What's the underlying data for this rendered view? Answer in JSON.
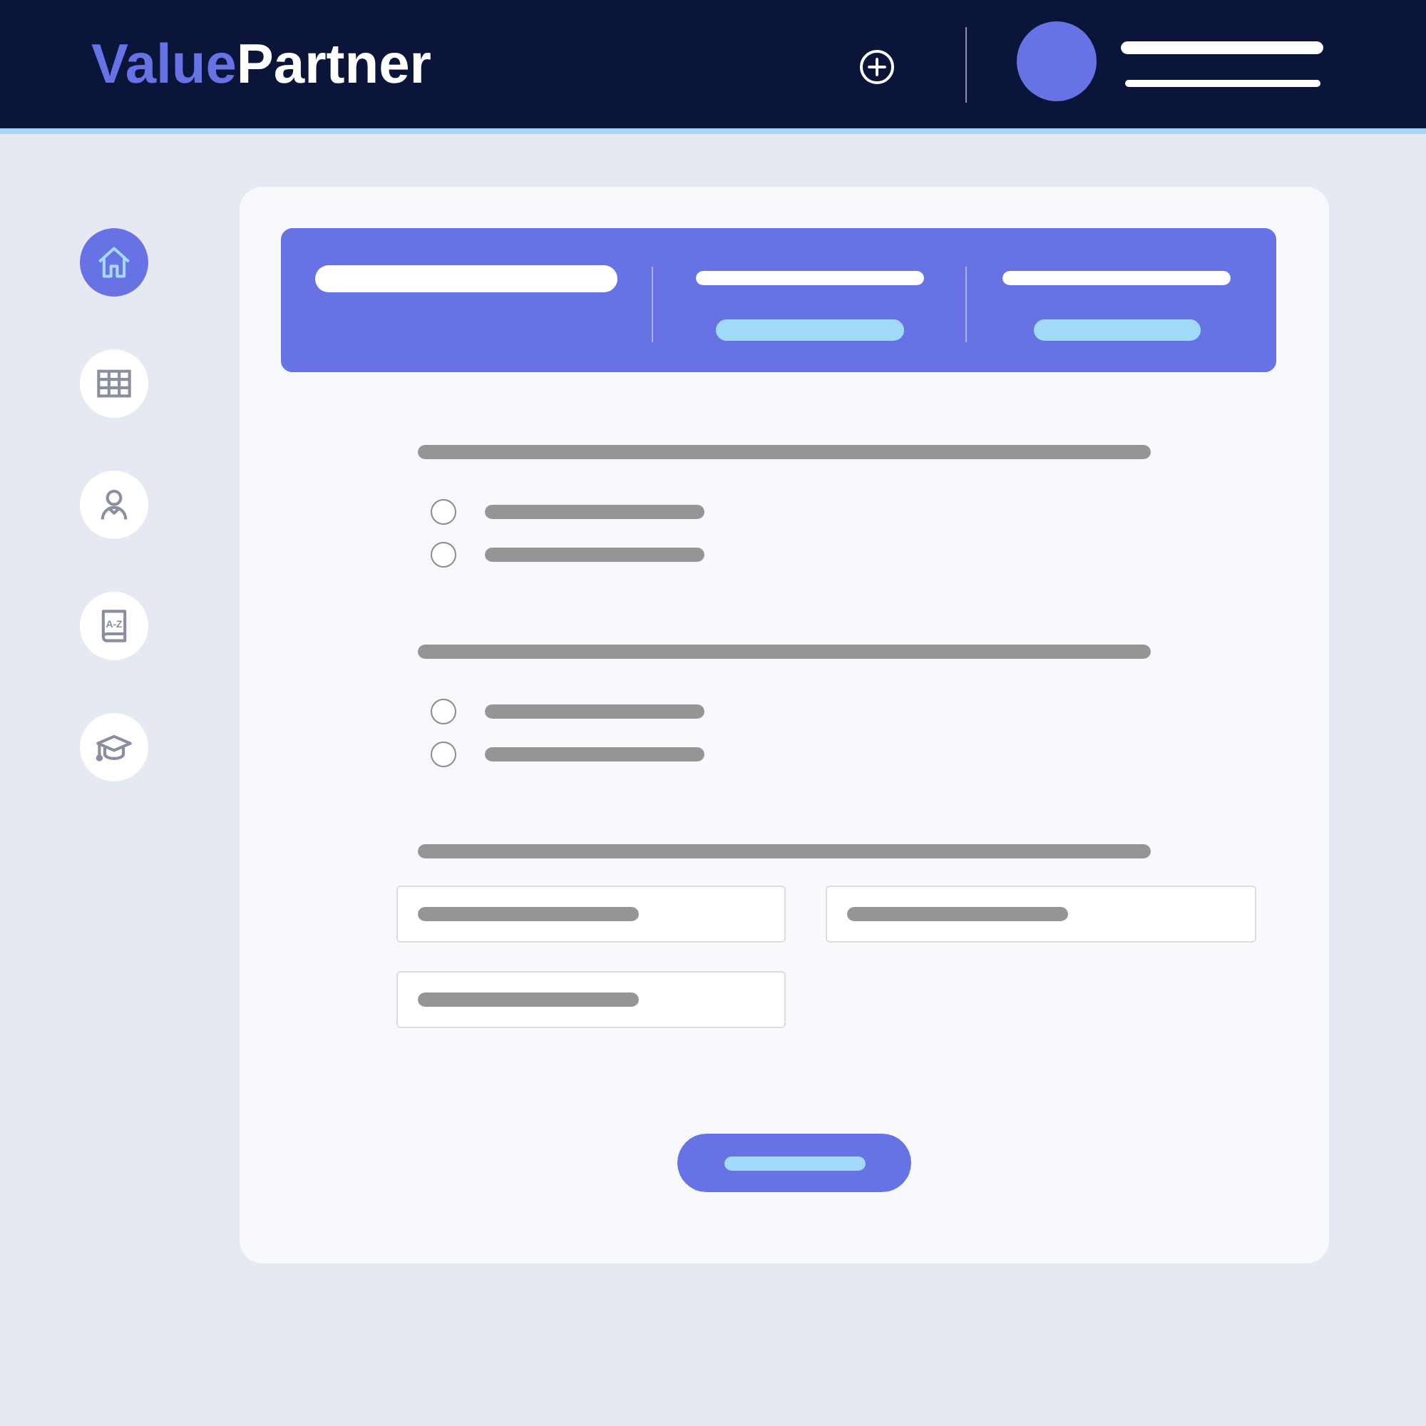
{
  "header": {
    "logo": {
      "accent": "Value",
      "rest": "Partner"
    }
  },
  "sidebar": {
    "items": [
      {
        "selected": true
      },
      {
        "selected": false
      },
      {
        "selected": false
      },
      {
        "icon_label": "A-Z",
        "selected": false
      },
      {
        "selected": false
      }
    ]
  },
  "summary_banner": {
    "stats": [
      {
        "kind": "stat"
      },
      {
        "kind": "stat"
      }
    ]
  },
  "form": {
    "sections": [
      {
        "kind": "radio_group",
        "options": [
          {
            "checked": false
          },
          {
            "checked": false
          }
        ]
      },
      {
        "kind": "radio_group",
        "options": [
          {
            "checked": false
          },
          {
            "checked": false
          }
        ]
      },
      {
        "kind": "field_group",
        "fields": [
          {
            "kind": "text"
          },
          {
            "kind": "text"
          },
          {
            "kind": "text"
          }
        ]
      }
    ],
    "actions": [
      {
        "kind": "primary"
      }
    ]
  }
}
